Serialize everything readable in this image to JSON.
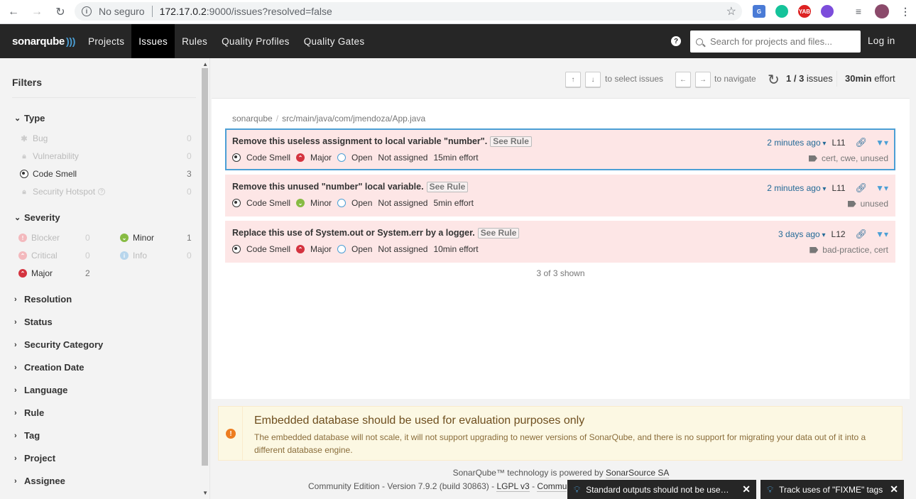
{
  "browser": {
    "security_label": "No seguro",
    "url_host": "172.17.0.2",
    "url_path": ":9000/issues?resolved=false",
    "ext_labels": [
      "G",
      "",
      "YAB",
      ""
    ]
  },
  "nav": {
    "logo": "sonarqube",
    "items": [
      "Projects",
      "Issues",
      "Rules",
      "Quality Profiles",
      "Quality Gates"
    ],
    "active": "Issues",
    "help": "?",
    "search_placeholder": "Search for projects and files...",
    "login": "Log in"
  },
  "sidebar": {
    "title": "Filters",
    "type": {
      "label": "Type",
      "items": [
        {
          "label": "Bug",
          "count": "0"
        },
        {
          "label": "Vulnerability",
          "count": "0"
        },
        {
          "label": "Code Smell",
          "count": "3"
        },
        {
          "label": "Security Hotspot",
          "count": "0"
        }
      ]
    },
    "severity": {
      "label": "Severity",
      "items": [
        {
          "label": "Blocker",
          "count": "0"
        },
        {
          "label": "Minor",
          "count": "1"
        },
        {
          "label": "Critical",
          "count": "0"
        },
        {
          "label": "Info",
          "count": "0"
        },
        {
          "label": "Major",
          "count": "2"
        }
      ]
    },
    "facets": [
      "Resolution",
      "Status",
      "Security Category",
      "Creation Date",
      "Language",
      "Rule",
      "Tag",
      "Project",
      "Assignee"
    ]
  },
  "toolbar": {
    "select_hint": "to select issues",
    "navigate_hint": "to navigate",
    "count": "1 / 3",
    "count_suffix": "issues",
    "effort": "30min",
    "effort_suffix": "effort",
    "up": "↑",
    "down": "↓",
    "left": "←",
    "right": "→"
  },
  "breadcrumb": {
    "project": "sonarqube",
    "path": "src/main/java/com/jmendoza/App.java"
  },
  "issues": [
    {
      "message": "Remove this useless assignment to local variable \"number\".",
      "see_rule": "See Rule",
      "type": "Code Smell",
      "severity": "Major",
      "status": "Open",
      "assignee": "Not assigned",
      "effort": "15min effort",
      "when": "2 minutes ago",
      "line": "L11",
      "tags": "cert, cwe, unused"
    },
    {
      "message": "Remove this unused \"number\" local variable.",
      "see_rule": "See Rule",
      "type": "Code Smell",
      "severity": "Minor",
      "status": "Open",
      "assignee": "Not assigned",
      "effort": "5min effort",
      "when": "2 minutes ago",
      "line": "L11",
      "tags": "unused"
    },
    {
      "message": "Replace this use of System.out or System.err by a logger.",
      "see_rule": "See Rule",
      "type": "Code Smell",
      "severity": "Major",
      "status": "Open",
      "assignee": "Not assigned",
      "effort": "10min effort",
      "when": "3 days ago",
      "line": "L12",
      "tags": "bad-practice, cert"
    }
  ],
  "shown": "3 of 3 shown",
  "warning": {
    "title": "Embedded database should be used for evaluation purposes only",
    "body": "The embedded database will not scale, it will not support upgrading to newer versions of SonarQube, and there is no support for migrating your data out of it into a different database engine."
  },
  "footer": {
    "powered": "SonarQube™ technology is powered by",
    "powered_link": "SonarSource SA",
    "edition": "Community Edition - Version 7.9.2 (build 30863) -",
    "license": "LGPL v3",
    "dash": "-",
    "community": "Commu",
    "tail": "e"
  },
  "notifications": [
    {
      "text": "Standard outputs should not be use…",
      "close": "✕"
    },
    {
      "text": "Track uses of \"FIXME\" tags",
      "close": "✕"
    }
  ],
  "colors": {
    "nav_bg": "#262626",
    "accent": "#4b9fd5",
    "issue_bg": "#fde6e6",
    "major": "#d4333f",
    "minor": "#87bb43",
    "warning_bg": "#fcf8e3"
  }
}
